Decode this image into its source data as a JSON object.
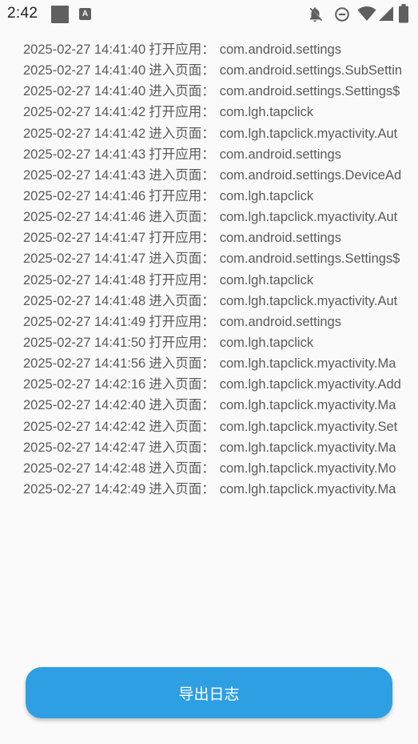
{
  "status_bar": {
    "time": "2:42",
    "notification_badge": "A",
    "icons": [
      "notification-square-icon",
      "app-a-icon",
      "bell-off-icon",
      "do-not-disturb-icon",
      "wifi-icon",
      "signal-icon",
      "battery-icon"
    ]
  },
  "log": [
    {
      "time": "2025-02-27 14:41:40",
      "action": "打开应用",
      "target": "com.android.settings"
    },
    {
      "time": "2025-02-27 14:41:40",
      "action": "进入页面",
      "target": "com.android.settings.SubSettin"
    },
    {
      "time": "2025-02-27 14:41:40",
      "action": "进入页面",
      "target": "com.android.settings.Settings$"
    },
    {
      "time": "2025-02-27 14:41:42",
      "action": "打开应用",
      "target": "com.lgh.tapclick"
    },
    {
      "time": "2025-02-27 14:41:42",
      "action": "进入页面",
      "target": "com.lgh.tapclick.myactivity.Aut"
    },
    {
      "time": "2025-02-27 14:41:43",
      "action": "打开应用",
      "target": "com.android.settings"
    },
    {
      "time": "2025-02-27 14:41:43",
      "action": "进入页面",
      "target": "com.android.settings.DeviceAd"
    },
    {
      "time": "2025-02-27 14:41:46",
      "action": "打开应用",
      "target": "com.lgh.tapclick"
    },
    {
      "time": "2025-02-27 14:41:46",
      "action": "进入页面",
      "target": "com.lgh.tapclick.myactivity.Aut"
    },
    {
      "time": "2025-02-27 14:41:47",
      "action": "打开应用",
      "target": "com.android.settings"
    },
    {
      "time": "2025-02-27 14:41:47",
      "action": "进入页面",
      "target": "com.android.settings.Settings$"
    },
    {
      "time": "2025-02-27 14:41:48",
      "action": "打开应用",
      "target": "com.lgh.tapclick"
    },
    {
      "time": "2025-02-27 14:41:48",
      "action": "进入页面",
      "target": "com.lgh.tapclick.myactivity.Aut"
    },
    {
      "time": "2025-02-27 14:41:49",
      "action": "打开应用",
      "target": "com.android.settings"
    },
    {
      "time": "2025-02-27 14:41:50",
      "action": "打开应用",
      "target": "com.lgh.tapclick"
    },
    {
      "time": "2025-02-27 14:41:56",
      "action": "进入页面",
      "target": "com.lgh.tapclick.myactivity.Ma"
    },
    {
      "time": "2025-02-27 14:42:16",
      "action": "进入页面",
      "target": "com.lgh.tapclick.myactivity.Add"
    },
    {
      "time": "2025-02-27 14:42:40",
      "action": "进入页面",
      "target": "com.lgh.tapclick.myactivity.Ma"
    },
    {
      "time": "2025-02-27 14:42:42",
      "action": "进入页面",
      "target": "com.lgh.tapclick.myactivity.Set"
    },
    {
      "time": "2025-02-27 14:42:47",
      "action": "进入页面",
      "target": "com.lgh.tapclick.myactivity.Ma"
    },
    {
      "time": "2025-02-27 14:42:48",
      "action": "进入页面",
      "target": "com.lgh.tapclick.myactivity.Mo"
    },
    {
      "time": "2025-02-27 14:42:49",
      "action": "进入页面",
      "target": "com.lgh.tapclick.myactivity.Ma"
    }
  ],
  "log_separator": "：",
  "export_button": {
    "label": "导出日志"
  },
  "colors": {
    "background": "#fafafa",
    "log_text": "#5a5a5a",
    "button": "#2f9fe3",
    "button_text": "#ffffff",
    "status_icons": "#5f5f5f"
  }
}
